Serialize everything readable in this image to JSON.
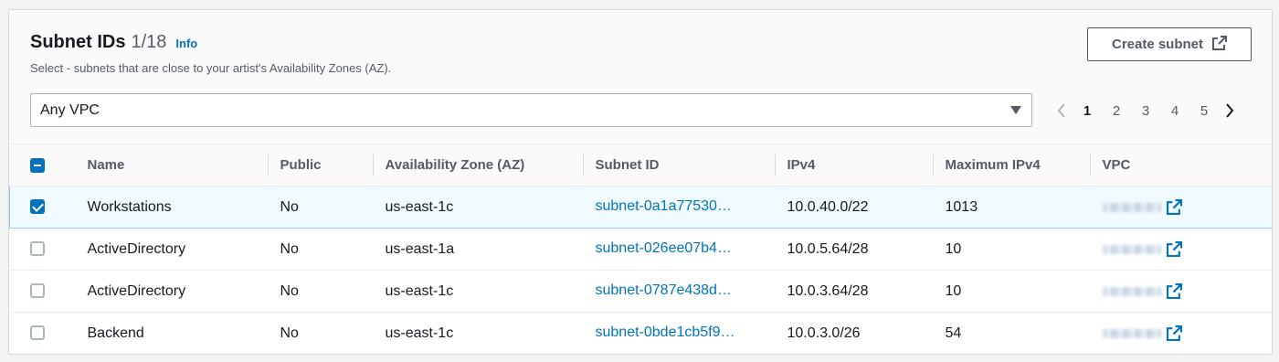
{
  "header": {
    "title": "Subnet IDs",
    "counter": "1/18",
    "info": "Info",
    "description": "Select - subnets that are close to your artist's Availability Zones (AZ).",
    "create_button": "Create subnet"
  },
  "filter": {
    "selected": "Any VPC"
  },
  "pagination": {
    "pages": [
      "1",
      "2",
      "3",
      "4",
      "5"
    ],
    "current": "1"
  },
  "table": {
    "columns": [
      "Name",
      "Public",
      "Availability Zone (AZ)",
      "Subnet ID",
      "IPv4",
      "Maximum IPv4",
      "VPC"
    ],
    "rows": [
      {
        "selected": true,
        "name": "Workstations",
        "public": "No",
        "az": "us-east-1c",
        "subnet_id": "subnet-0a1a77530…",
        "ipv4": "10.0.40.0/22",
        "max_ipv4": "1013"
      },
      {
        "selected": false,
        "name": "ActiveDirectory",
        "public": "No",
        "az": "us-east-1a",
        "subnet_id": "subnet-026ee07b4…",
        "ipv4": "10.0.5.64/28",
        "max_ipv4": "10"
      },
      {
        "selected": false,
        "name": "ActiveDirectory",
        "public": "No",
        "az": "us-east-1c",
        "subnet_id": "subnet-0787e438d…",
        "ipv4": "10.0.3.64/28",
        "max_ipv4": "10"
      },
      {
        "selected": false,
        "name": "Backend",
        "public": "No",
        "az": "us-east-1c",
        "subnet_id": "subnet-0bde1cb5f9…",
        "ipv4": "10.0.3.0/26",
        "max_ipv4": "54"
      }
    ]
  },
  "colors": {
    "link": "#0073bb",
    "checkbox": "#0073bb",
    "selected_row_bg": "#f1faff",
    "selected_row_border": "#99cbe4"
  },
  "icons": {
    "external_link": "external-link-icon",
    "dropdown": "caret-down-icon",
    "prev": "chevron-left-icon",
    "next": "chevron-right-icon"
  }
}
